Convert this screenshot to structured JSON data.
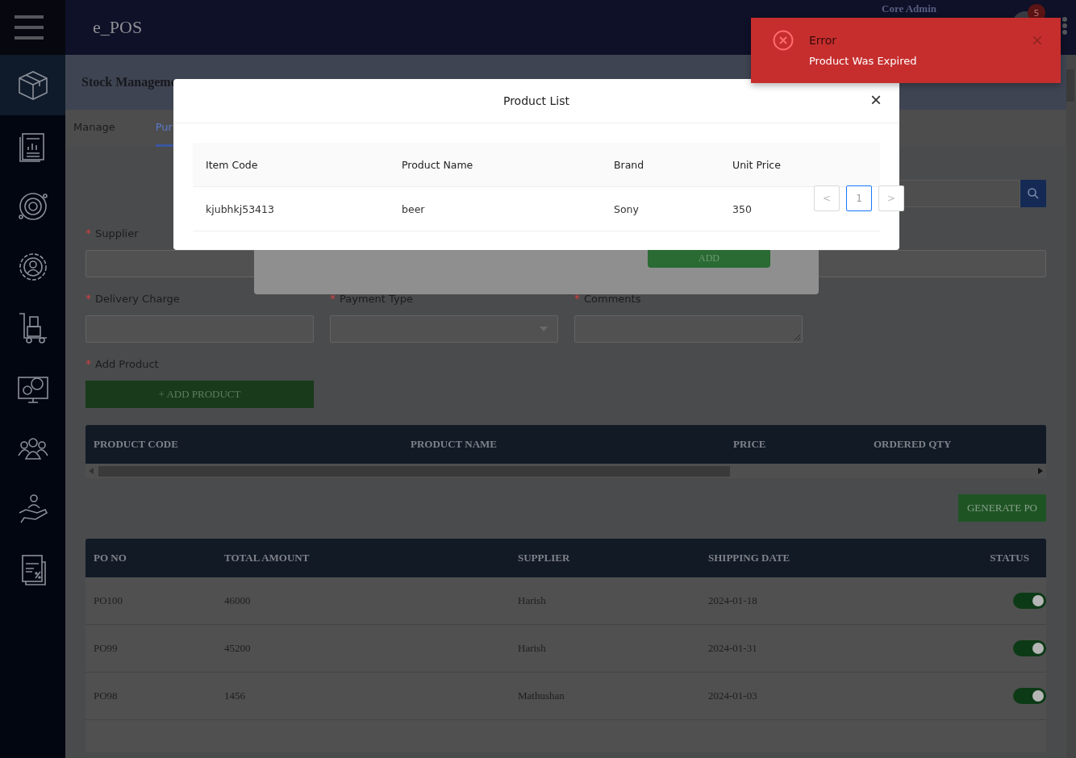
{
  "header": {
    "app_name": "e_POS",
    "user_name": "Core Admin",
    "notification_count": "5"
  },
  "sidebar": {
    "items": [
      {
        "kind": "box",
        "selected": true
      },
      {
        "kind": "report",
        "selected": false
      },
      {
        "kind": "gear",
        "selected": false
      },
      {
        "kind": "user-gear",
        "selected": false
      },
      {
        "kind": "trolley",
        "selected": false
      },
      {
        "kind": "monitor-gear",
        "selected": false
      },
      {
        "kind": "team",
        "selected": false
      },
      {
        "kind": "hand",
        "selected": false
      },
      {
        "kind": "tax",
        "selected": false
      }
    ]
  },
  "breadcrumb": "Stock Manageme",
  "tabs": [
    {
      "label": "Manage",
      "selected": false
    },
    {
      "label": "Pur",
      "selected": true
    }
  ],
  "form": {
    "fields": [
      {
        "label": "Supplier",
        "required_mark": "*",
        "kind": "input"
      },
      {
        "label": "Delivery Charge",
        "required_mark": "*",
        "kind": "input"
      },
      {
        "label": "Payment Type",
        "required_mark": "*",
        "kind": "select"
      },
      {
        "label": "Comments",
        "required_mark": "*",
        "kind": "textarea"
      },
      {
        "label": "Add Product",
        "required_mark": "*",
        "kind": "button",
        "button": "+ ADD PRODUCT"
      }
    ]
  },
  "product_table": {
    "columns": [
      "PRODUCT CODE",
      "PRODUCT NAME",
      "PRICE",
      "ORDERED QTY"
    ]
  },
  "generate_button": "GENERATE PO",
  "po_table": {
    "columns": [
      "PO NO",
      "TOTAL AMOUNT",
      "SUPPLIER",
      "SHIPPING DATE",
      "STATUS"
    ],
    "rows": [
      {
        "cells": [
          "PO100",
          "46000",
          "Harish",
          "2024-01-18"
        ],
        "on": true
      },
      {
        "cells": [
          "PO99",
          "45200",
          "Harish",
          "2024-01-31"
        ],
        "on": true
      },
      {
        "cells": [
          "PO98",
          "1456",
          "Mathushan",
          "2024-01-03"
        ],
        "on": true
      }
    ]
  },
  "background_dialog": {
    "button": "ADD"
  },
  "product_dialog": {
    "title": "Product List",
    "close": "×",
    "columns": [
      "Item Code",
      "Product Name",
      "Brand",
      "Unit Price"
    ],
    "rows": [
      [
        "kjubhkj53413",
        "beer",
        "Sony",
        "350"
      ]
    ],
    "pagination": {
      "prev": "<",
      "next": ">",
      "pages": [
        {
          "label": "1",
          "selected": true
        }
      ]
    }
  },
  "toast": {
    "kind": "error",
    "title": "Error",
    "message": "Product Was Expired"
  }
}
